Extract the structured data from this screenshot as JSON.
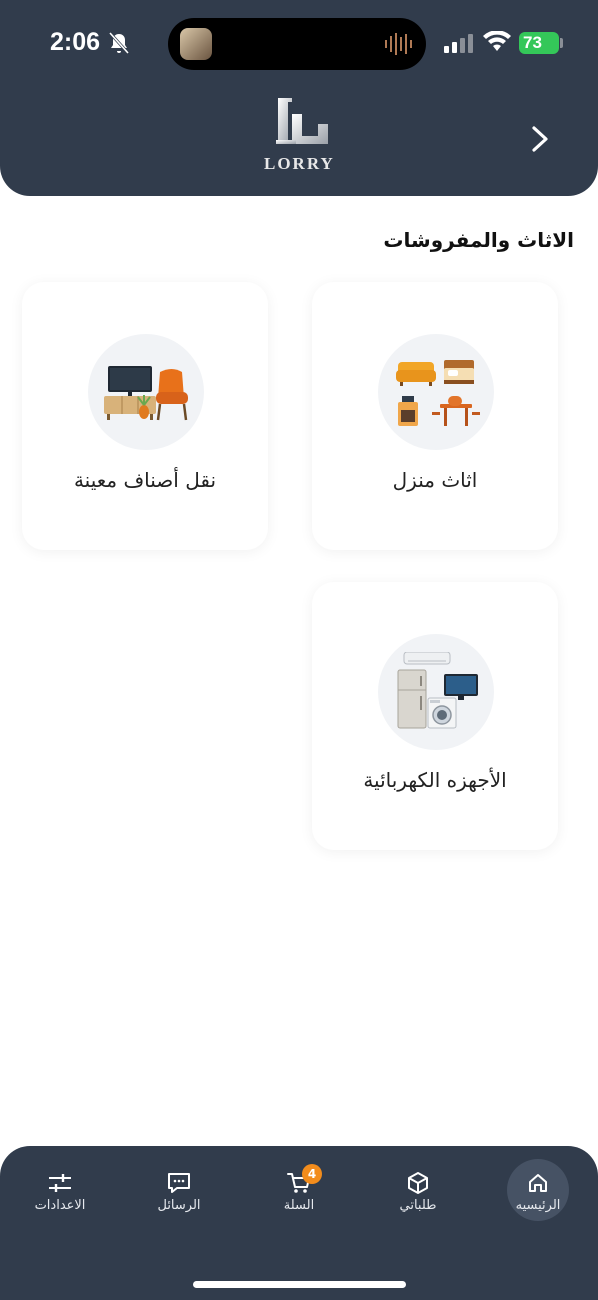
{
  "status": {
    "time": "2:06",
    "battery": "73"
  },
  "header": {
    "logo_text": "LORRY",
    "back_icon": "chevron-right-icon"
  },
  "section": {
    "title": "الاثاث والمفروشات"
  },
  "categories": [
    {
      "label": "اثاث منزل",
      "icon": "home-furniture-icon"
    },
    {
      "label": "نقل أصناف معينة",
      "icon": "tv-chair-icon"
    },
    {
      "label": "الأجهزه الكهربائية",
      "icon": "appliances-icon"
    }
  ],
  "nav": {
    "items": [
      {
        "label": "الرئيسيه",
        "icon": "home-icon",
        "active": true
      },
      {
        "label": "طلباتي",
        "icon": "box-icon"
      },
      {
        "label": "السلة",
        "icon": "cart-icon",
        "badge": "4"
      },
      {
        "label": "الرسائل",
        "icon": "chat-icon"
      },
      {
        "label": "الاعدادات",
        "icon": "sliders-icon"
      }
    ]
  },
  "colors": {
    "header_bg": "#313c4c",
    "accent_badge": "#f28c1c",
    "battery": "#34c759"
  }
}
